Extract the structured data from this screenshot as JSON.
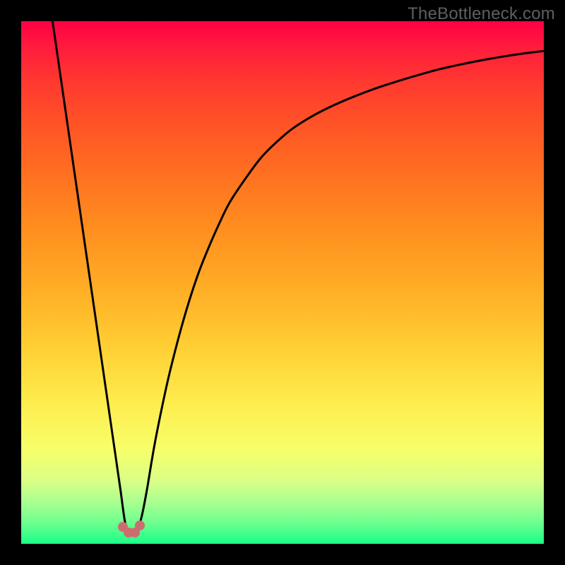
{
  "attribution": "TheBottleneck.com",
  "colors": {
    "gradient_top": "#ff0043",
    "gradient_bottom": "#18ff87",
    "curve": "#000000",
    "marker": "#cc6d6d",
    "background": "#000000"
  },
  "chart_data": {
    "type": "line",
    "title": "",
    "xlabel": "",
    "ylabel": "",
    "xlim": [
      0,
      100
    ],
    "ylim": [
      0,
      100
    ],
    "series": [
      {
        "name": "bottleneck-curve",
        "x": [
          6,
          7,
          8,
          9,
          10,
          11,
          12,
          13,
          14,
          15,
          16,
          17,
          18,
          19,
          20,
          21,
          22,
          23,
          24,
          25,
          26,
          28,
          30,
          32,
          34,
          36,
          38,
          40,
          43,
          46,
          49,
          52,
          56,
          60,
          64,
          68,
          72,
          76,
          80,
          84,
          88,
          92,
          96,
          100
        ],
        "y": [
          100,
          93.1,
          86.2,
          79.3,
          72.4,
          65.5,
          58.6,
          51.7,
          44.8,
          37.9,
          31.0,
          24.1,
          17.2,
          10.3,
          3.5,
          2.0,
          2.0,
          5.0,
          10.0,
          16.0,
          21.5,
          31.0,
          39.0,
          46.0,
          52.0,
          57.0,
          61.5,
          65.5,
          70.0,
          74.0,
          77.0,
          79.5,
          82.0,
          84.0,
          85.7,
          87.2,
          88.5,
          89.7,
          90.8,
          91.7,
          92.5,
          93.2,
          93.8,
          94.3
        ]
      }
    ],
    "markers": [
      {
        "x": 19.5,
        "y": 3.2
      },
      {
        "x": 20.5,
        "y": 2.2
      },
      {
        "x": 21.8,
        "y": 2.2
      },
      {
        "x": 22.7,
        "y": 3.5
      }
    ]
  }
}
